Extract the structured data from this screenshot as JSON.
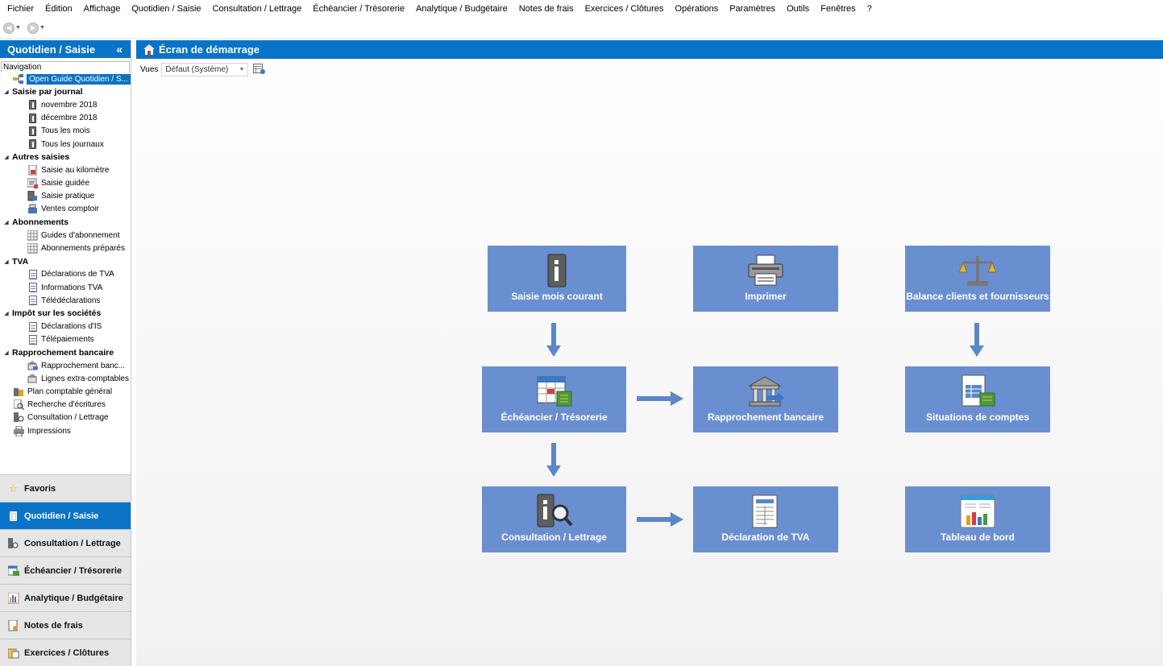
{
  "menu": [
    "Fichier",
    "Édition",
    "Affichage",
    "Quotidien / Saisie",
    "Consultation / Lettrage",
    "Échéancier / Trésorerie",
    "Analytique / Budgétaire",
    "Notes de frais",
    "Exercices / Clôtures",
    "Opérations",
    "Paramètres",
    "Outils",
    "Fenêtres",
    "?"
  ],
  "left_panel": {
    "title": "Quotidien / Saisie",
    "collapse_glyph": "«",
    "nav_title": "Navigation",
    "tree": {
      "open_guide": "Open Guide Quotidien / S...",
      "saisie_journal": {
        "label": "Saisie par journal",
        "items": [
          "novembre 2018",
          "décembre 2018",
          "Tous les mois",
          "Tous les journaux"
        ]
      },
      "autres_saisies": {
        "label": "Autres saisies",
        "items": [
          "Saisie au kilomètre",
          "Saisie guidée",
          "Saisie pratique",
          "Ventes comptoir"
        ]
      },
      "abonnements": {
        "label": "Abonnements",
        "items": [
          "Guides d'abonnement",
          "Abonnements préparés"
        ]
      },
      "tva": {
        "label": "TVA",
        "items": [
          "Déclarations de TVA",
          "Informations TVA",
          "Télédéclarations"
        ]
      },
      "impot": {
        "label": "Impôt sur les sociétés",
        "items": [
          "Déclarations d'IS",
          "Télépaiements"
        ]
      },
      "rappro": {
        "label": "Rapprochement bancaire",
        "items": [
          "Rapprochement banc...",
          "Lignes extra-comptables"
        ]
      },
      "root_items": [
        "Plan comptable général",
        "Recherche d'écritures",
        "Consultation / Lettrage",
        "Impressions"
      ]
    },
    "bottom_nav": [
      "Favoris",
      "Quotidien / Saisie",
      "Consultation / Lettrage",
      "Échéancier / Trésorerie",
      "Analytique / Budgétaire",
      "Notes de frais",
      "Exercices / Clôtures"
    ]
  },
  "main": {
    "title": "Écran de démarrage",
    "views_label": "Vues",
    "views_value": "Défaut (Système)",
    "tiles": {
      "saisie": "Saisie mois courant",
      "imprimer": "Imprimer",
      "balance": "Balance clients et fournisseurs",
      "echeancier": "Échéancier / Trésorerie",
      "rappro": "Rapprochement bancaire",
      "situations": "Situations de comptes",
      "consultation": "Consultation / Lettrage",
      "tva": "Déclaration de TVA",
      "tableau": "Tableau de bord"
    }
  },
  "colors": {
    "accent": "#0a73c6",
    "tile": "#6a8fd0",
    "arrow": "#5b86c9"
  },
  "icons": {
    "home": "home-icon",
    "settings": "views-settings-icon",
    "star": "star-icon"
  }
}
